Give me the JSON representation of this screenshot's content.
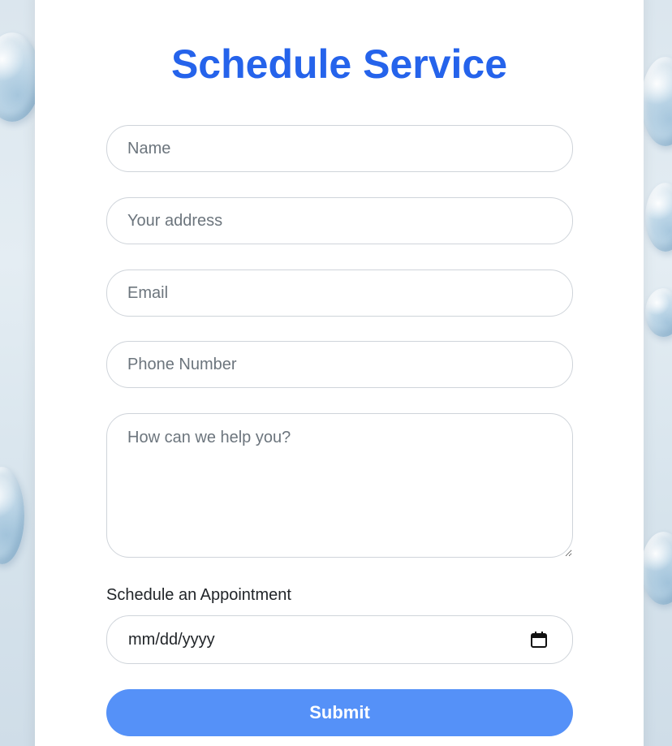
{
  "form": {
    "title": "Schedule Service",
    "name_placeholder": "Name",
    "address_placeholder": "Your address",
    "email_placeholder": "Email",
    "phone_placeholder": "Phone Number",
    "message_placeholder": "How can we help you?",
    "appointment_label": "Schedule an Appointment",
    "date_placeholder": "mm/dd/yyyy",
    "submit_label": "Submit"
  },
  "icons": {
    "date_picker": "calendar-icon"
  },
  "colors": {
    "title": "#2563eb",
    "submit_button": "#5591f8"
  }
}
